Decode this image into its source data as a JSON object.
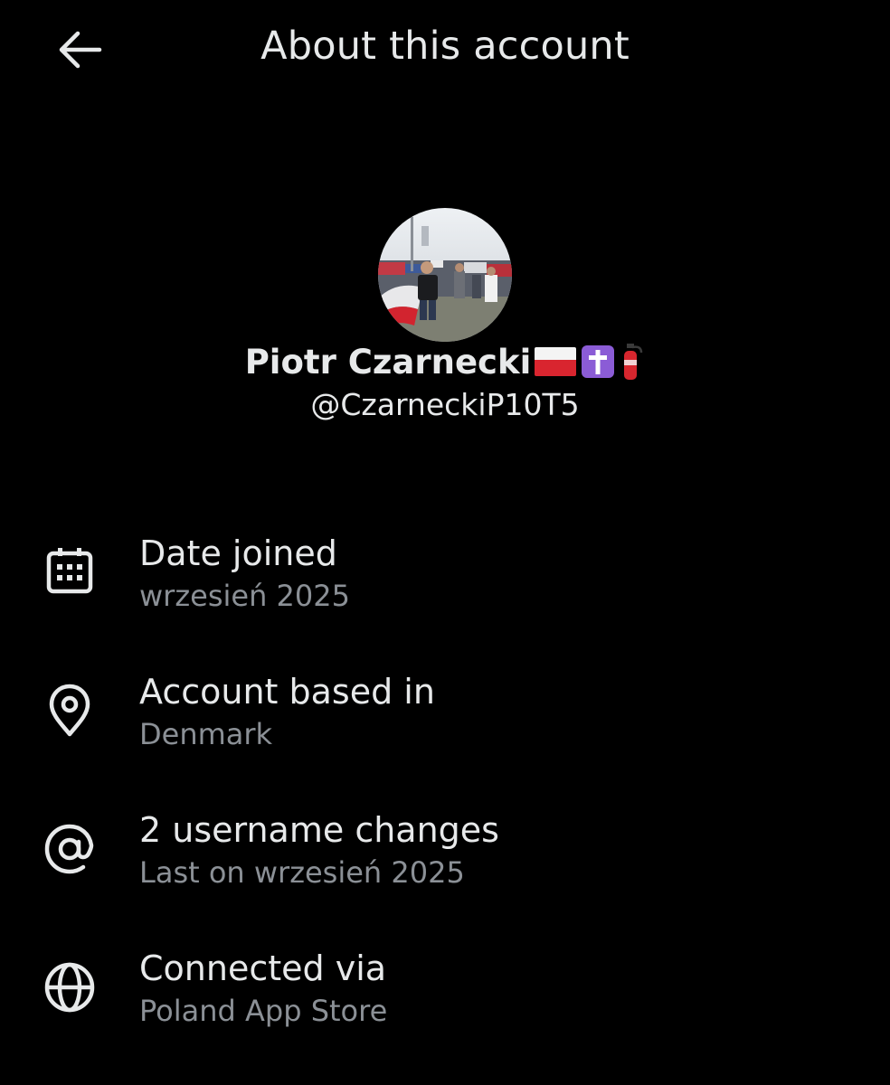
{
  "header": {
    "title": "About this account",
    "back_icon": "arrow-left-icon"
  },
  "profile": {
    "name": "Piotr Czarnecki",
    "name_emojis": [
      "poland-flag",
      "latin-cross",
      "fire-extinguisher"
    ],
    "handle": "@CzarneckiP10T5"
  },
  "info": {
    "date_joined": {
      "label": "Date joined",
      "value": "wrzesień 2025",
      "icon": "calendar-icon"
    },
    "based_in": {
      "label": "Account based in",
      "value": "Denmark",
      "icon": "location-pin-icon"
    },
    "username_changes": {
      "label": "2 username changes",
      "value": "Last on wrzesień 2025",
      "icon": "at-sign-icon"
    },
    "connected_via": {
      "label": "Connected via",
      "value": "Poland App Store",
      "icon": "globe-icon"
    }
  },
  "colors": {
    "background": "#000000",
    "primary_text": "#e7e9ea",
    "secondary_text": "#8b9096"
  }
}
